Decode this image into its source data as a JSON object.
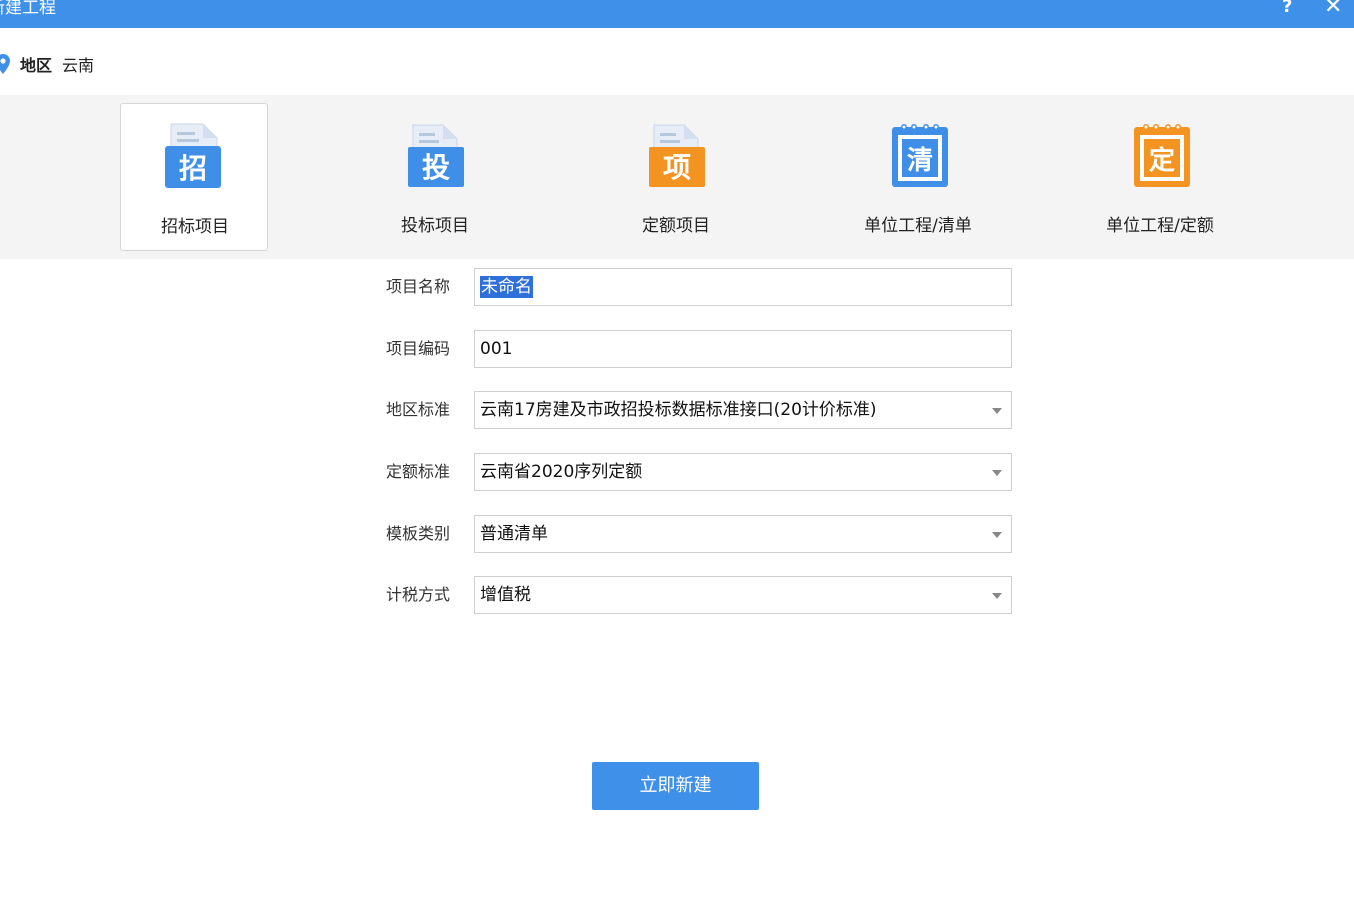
{
  "window": {
    "title": "新建工程",
    "help_label": "?",
    "close_label": "✕"
  },
  "region": {
    "label": "地区",
    "value": "云南"
  },
  "project_types": [
    {
      "label": "招标项目",
      "glyph": "招",
      "icon": "bid-document-icon",
      "color": "#3f8fe8",
      "selected": true
    },
    {
      "label": "投标项目",
      "glyph": "投",
      "icon": "tender-document-icon",
      "color": "#3f8fe8",
      "selected": false
    },
    {
      "label": "定额项目",
      "glyph": "项",
      "icon": "quota-document-icon",
      "color": "#f39422",
      "selected": false
    },
    {
      "label": "单位工程/清单",
      "glyph": "清",
      "icon": "notebook-list-icon",
      "color": "#3f8fe8",
      "selected": false
    },
    {
      "label": "单位工程/定额",
      "glyph": "定",
      "icon": "notebook-quota-icon",
      "color": "#f39422",
      "selected": false
    }
  ],
  "form": {
    "project_name": {
      "label": "项目名称",
      "value": "未命名"
    },
    "project_code": {
      "label": "项目编码",
      "value": "001"
    },
    "region_standard": {
      "label": "地区标准",
      "value": "云南17房建及市政招投标数据标准接口(20计价标准)"
    },
    "quota_standard": {
      "label": "定额标准",
      "value": "云南省2020序列定额"
    },
    "template_type": {
      "label": "模板类别",
      "value": "普通清单"
    },
    "tax_method": {
      "label": "计税方式",
      "value": "增值税"
    }
  },
  "actions": {
    "create_label": "立即新建"
  },
  "colors": {
    "accent": "#3f90e9",
    "orange": "#f39422",
    "type_bar_bg": "#f4f4f4"
  }
}
